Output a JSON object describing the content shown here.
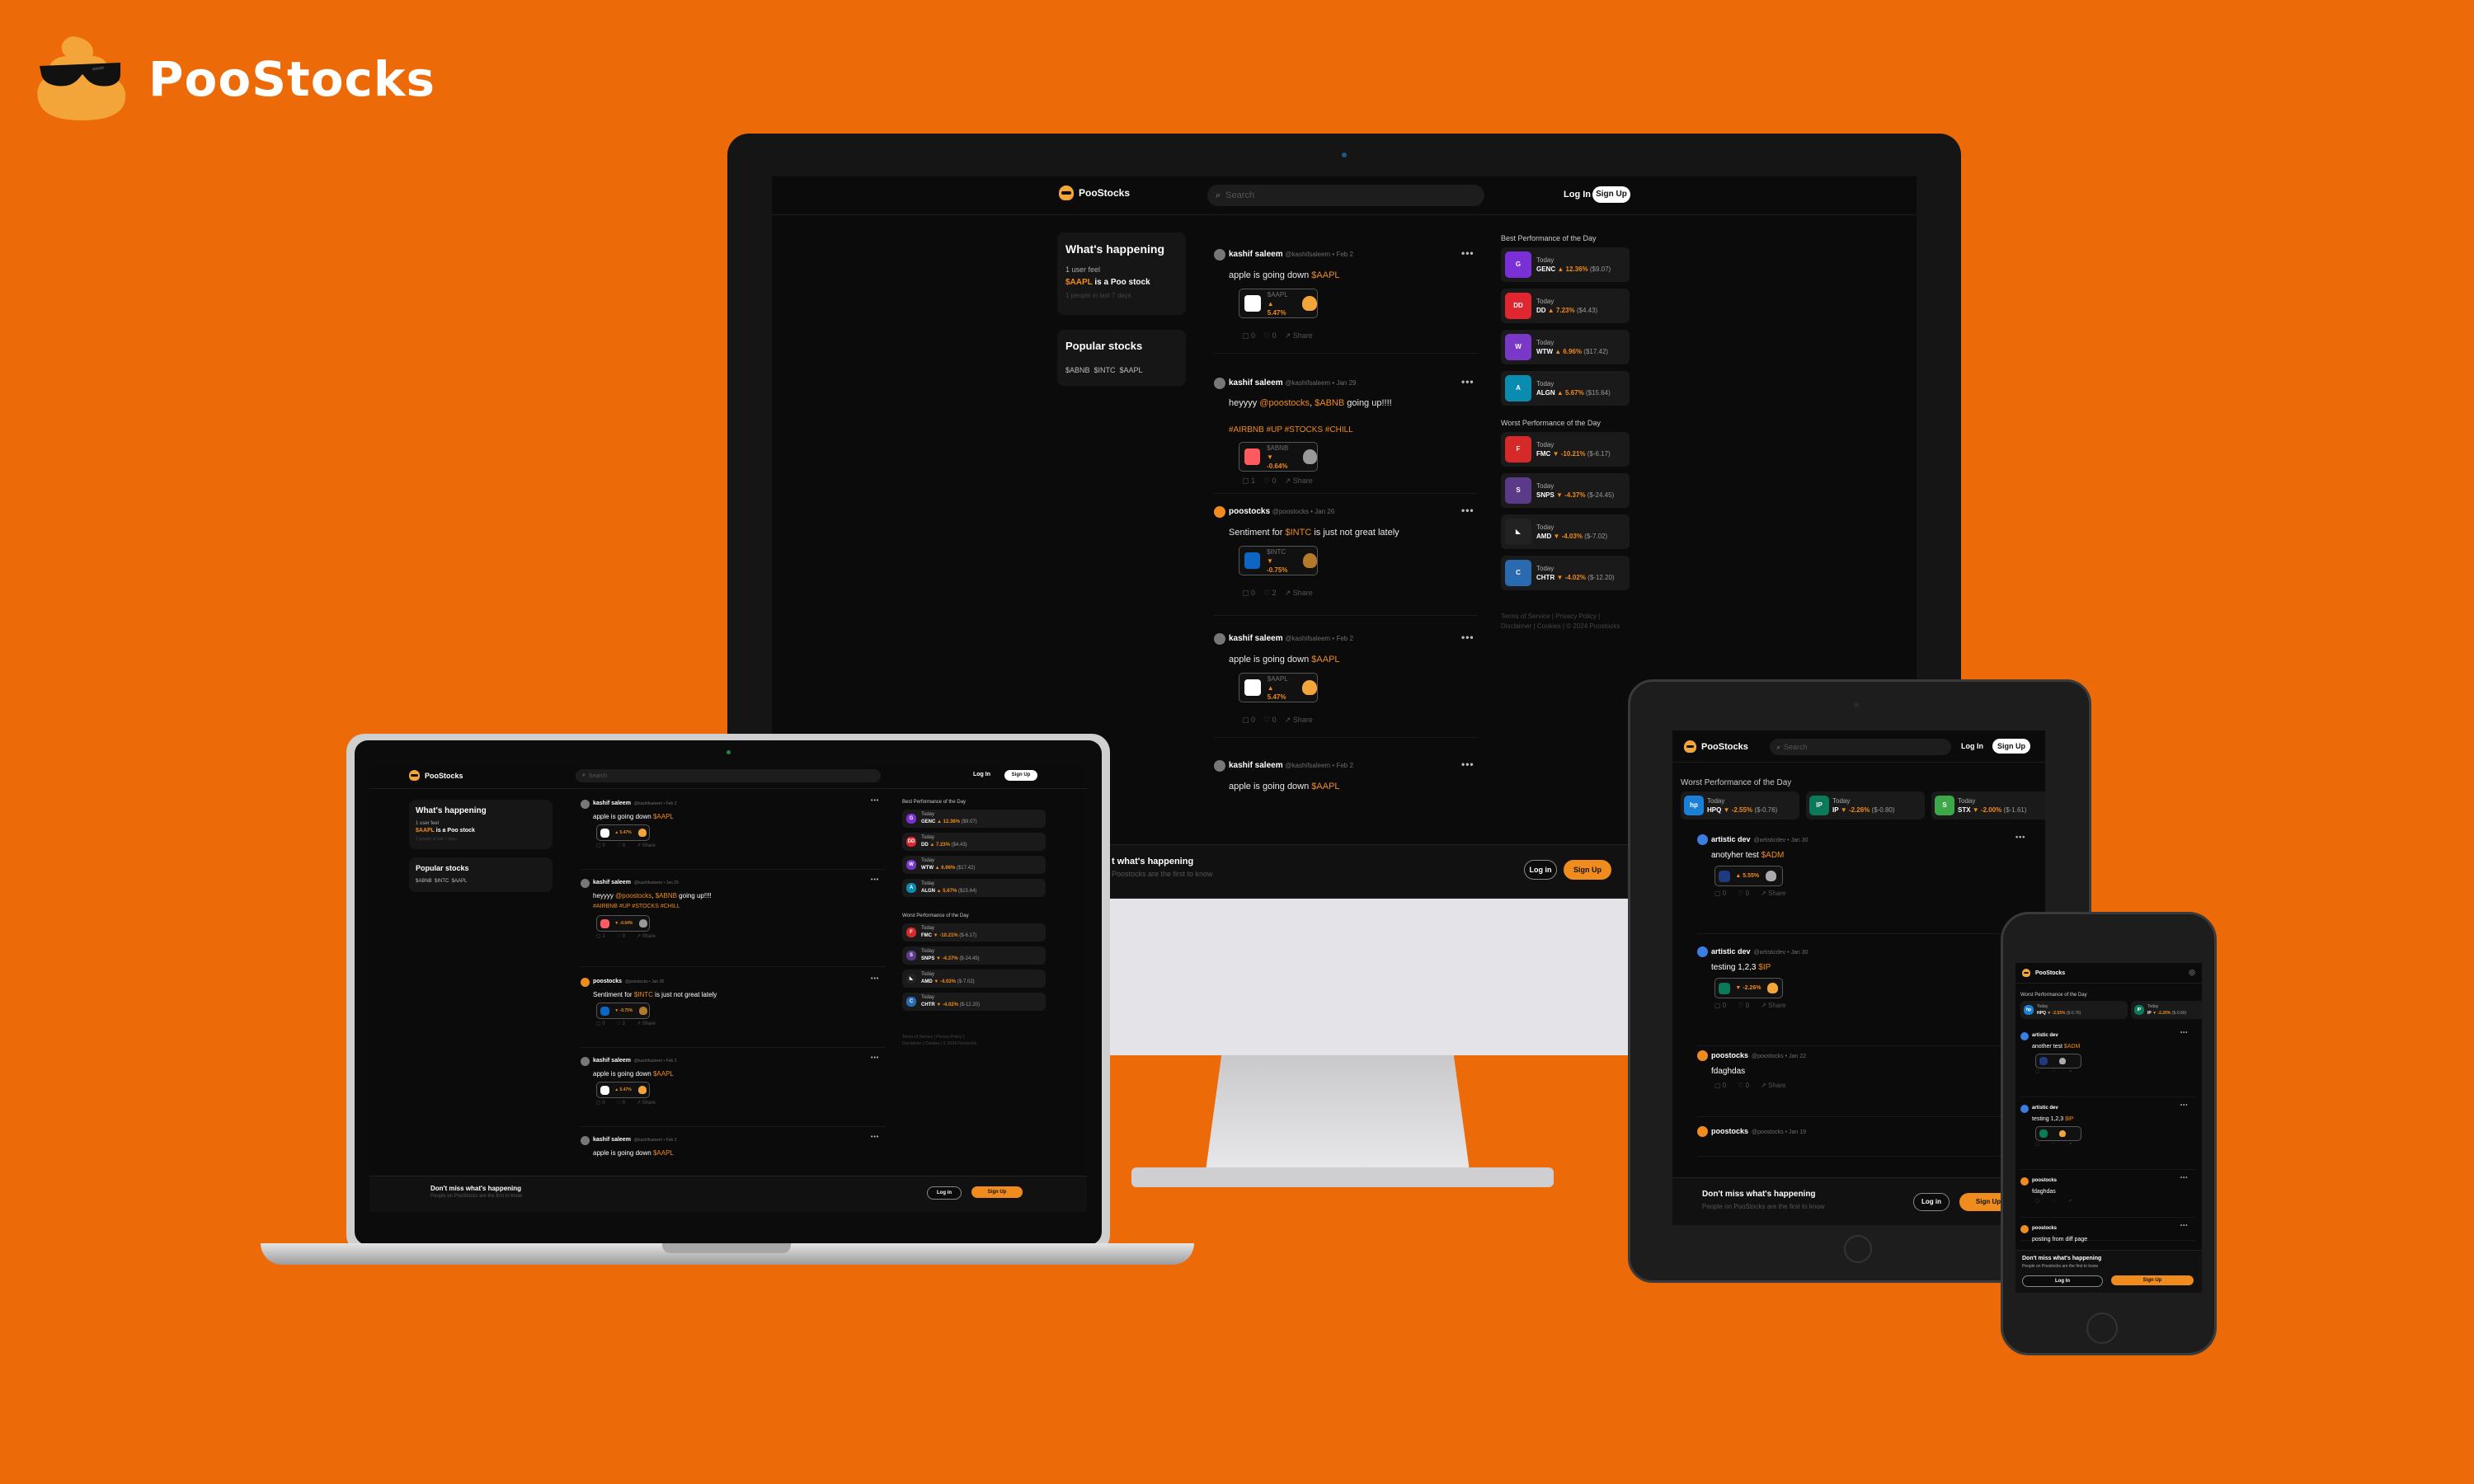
{
  "brand": {
    "name": "PooStocks"
  },
  "app": {
    "logo_text": "PooStocks",
    "search_placeholder": "Search",
    "login": "Log In",
    "signup": "Sign Up"
  },
  "sidebar": {
    "whats_happening": {
      "title": "What's happening",
      "users_line": "1 user feel",
      "ticker": "$AAPL",
      "rest": " is a Poo stock",
      "meta": "1 people in last 7 days"
    },
    "popular": {
      "title": "Popular stocks",
      "tags": "$ABNB  $INTC  $AAPL"
    }
  },
  "posts": [
    {
      "user": "kashif saleem",
      "handle": "@kashifsaleem • Feb 2",
      "pre": "apple is going down ",
      "ticker": "$AAPL",
      "post": "",
      "tags": "",
      "chip_symbol": "$AAPL",
      "chip_change": "▲ 5.47%",
      "replies": "0",
      "likes": "0",
      "share": "Share"
    },
    {
      "user": "kashif saleem",
      "handle": "@kashifsaleem • Jan 29",
      "pre": "heyyyy ",
      "ticker": "@poostocks",
      "mid": ", ",
      "ticker2": "$ABNB",
      "post": " going up!!!!",
      "tags": "#AIRBNB #UP #STOCKS #CHILL",
      "chip_symbol": "$ABNB",
      "chip_change": "▼ -0.64%",
      "replies": "1",
      "likes": "0",
      "share": "Share"
    },
    {
      "user": "poostocks",
      "handle": "@poostocks • Jan 26",
      "pre": "Sentiment for ",
      "ticker": "$INTC",
      "post": " is just not great lately",
      "tags": "",
      "chip_symbol": "$INTC",
      "chip_change": "▼ -0.75%",
      "replies": "0",
      "likes": "2",
      "share": "Share"
    },
    {
      "user": "kashif saleem",
      "handle": "@kashifsaleem • Feb 2",
      "pre": "apple is going down ",
      "ticker": "$AAPL",
      "post": "",
      "tags": "",
      "chip_symbol": "$AAPL",
      "chip_change": "▲ 5.47%",
      "replies": "0",
      "likes": "0",
      "share": "Share"
    },
    {
      "user": "kashif saleem",
      "handle": "@kashifsaleem • Feb 2",
      "pre": "apple is going down ",
      "ticker": "$AAPL",
      "post": "",
      "tags": "",
      "chip_symbol": "$AAPL",
      "chip_change": "",
      "replies": "",
      "likes": "",
      "share": ""
    }
  ],
  "performance": {
    "best_title": "Best Performance of the Day",
    "worst_title": "Worst Performance of the Day",
    "today": "Today",
    "best": [
      {
        "symbol": "GENC",
        "change": "▲ 12.36%",
        "price": "($9.07)",
        "color": "#7b2fd6",
        "glyph": "G"
      },
      {
        "symbol": "DD",
        "change": "▲ 7.23%",
        "price": "($4.43)",
        "color": "#e0262f",
        "glyph": "DD"
      },
      {
        "symbol": "WTW",
        "change": "▲ 6.96%",
        "price": "($17.42)",
        "color": "#7a38c9",
        "glyph": "W"
      },
      {
        "symbol": "ALGN",
        "change": "▲ 5.67%",
        "price": "($15.64)",
        "color": "#0a8bb0",
        "glyph": "A"
      }
    ],
    "worst": [
      {
        "symbol": "FMC",
        "change": "▼ -10.21%",
        "price": "($-6.17)",
        "color": "#d62a2a",
        "glyph": "F"
      },
      {
        "symbol": "SNPS",
        "change": "▼ -4.37%",
        "price": "($-24.45)",
        "color": "#5b3a8a",
        "glyph": "S"
      },
      {
        "symbol": "AMD",
        "change": "▼ -4.03%",
        "price": "($-7.02)",
        "color": "#222222",
        "glyph": "◣"
      },
      {
        "symbol": "CHTR",
        "change": "▼ -4.02%",
        "price": "($-12.20)",
        "color": "#2a6ab0",
        "glyph": "C"
      }
    ],
    "footer1": "Terms of Service | Privacy Policy |",
    "footer2": "Disclaimer | Cookies | © 2024 Poostocks"
  },
  "banner": {
    "title": "Don't miss what's happening",
    "title_cut": "t what's happening",
    "sub": "People on PooStocks are the first to know",
    "sub_cut": "Poostocks are the first to know",
    "login": "Log in",
    "signup": "Sign Up"
  },
  "tablet": {
    "worst_title": "Worst Performance of the Day",
    "worst": [
      {
        "symbol": "HPQ",
        "change": "▼ -2.55%",
        "price": "($-0.76)",
        "color": "#1c7fd6",
        "glyph": "hp"
      },
      {
        "symbol": "IP",
        "change": "▼ -2.26%",
        "price": "($-0.80)",
        "color": "#0a7a5a",
        "glyph": "IP"
      },
      {
        "symbol": "STX",
        "change": "▼ -2.00%",
        "price": "($-1.61)",
        "color": "#3ca84a",
        "glyph": "S"
      }
    ],
    "posts": [
      {
        "user": "artistic dev",
        "handle": "@artisticdev • Jan 30",
        "pre": "anotyher test ",
        "ticker": "$ADM",
        "post": "",
        "chip_change": "▲ 5.55%",
        "replies": "0",
        "likes": "0",
        "share": "Share"
      },
      {
        "user": "artistic dev",
        "handle": "@artisticdev • Jan 30",
        "pre": "testing 1,2,3 ",
        "ticker": "$IP",
        "post": "",
        "chip_change": "▼ -2.26%",
        "replies": "0",
        "likes": "0",
        "share": "Share"
      },
      {
        "user": "poostocks",
        "handle": "@poostocks • Jan 22",
        "pre": "fdaghdas",
        "ticker": "",
        "post": "",
        "chip_change": "",
        "replies": "0",
        "likes": "0",
        "share": "Share"
      },
      {
        "user": "poostocks",
        "handle": "@poostocks • Jan 19",
        "pre": "",
        "ticker": "",
        "post": "",
        "chip_change": "",
        "replies": "",
        "likes": "",
        "share": ""
      }
    ]
  },
  "phone": {
    "logo_text": "PooStocks",
    "worst_title": "Worst Performance of the Day",
    "posts": [
      {
        "user": "artistic dev",
        "pre": "another test ",
        "ticker": "$ADM"
      },
      {
        "user": "artistic dev",
        "pre": "testing 1,2,3 ",
        "ticker": "$IP"
      },
      {
        "user": "poostocks",
        "pre": "fdaghdas",
        "ticker": ""
      },
      {
        "user": "poostocks",
        "pre": "posting from diff page",
        "ticker": ""
      }
    ],
    "banner_title": "Don't miss what's happening",
    "banner_sub": "People on Poostocks are the first to know",
    "login": "Log In",
    "signup": "Sign Up"
  }
}
